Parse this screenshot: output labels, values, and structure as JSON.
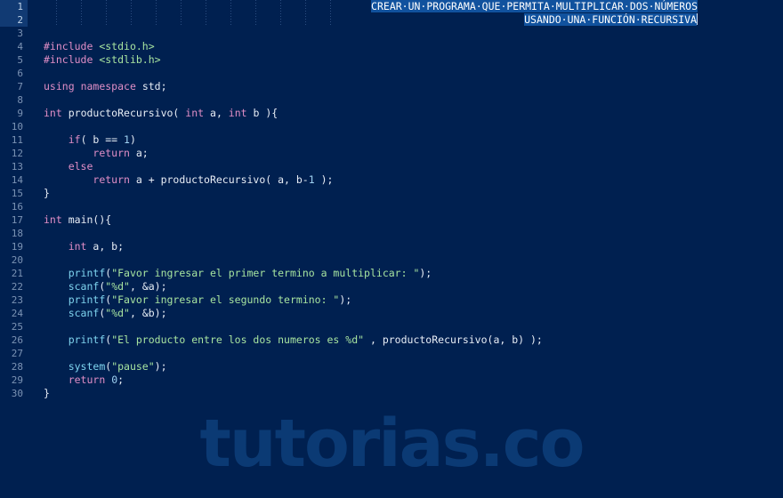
{
  "editor": {
    "watermark": "tutorias.co",
    "colors": {
      "background": "#002050",
      "gutter_text": "#7b93b4",
      "selection": "#11529e",
      "keyword": "#e08ec6",
      "string": "#a7e4a0",
      "function": "#7fd4ef",
      "number": "#9fd2f2",
      "identifier": "#e8eef6",
      "watermark": "#0b3a74"
    },
    "selected_text": "CREAR UN PROGRAMA QUE PERMITA MULTIPLICAR DOS NÚMEROS USANDO UNA FUNCIÓN RECURSIVA",
    "title_line_1": "CREAR·UN·PROGRAMA·QUE·PERMITA·MULTIPLICAR·DOS·NÚMEROS",
    "title_line_2": "USANDO·UNA·FUNCIÓN·RECURSIVA",
    "line_numbers": [
      1,
      2,
      3,
      4,
      5,
      6,
      7,
      8,
      9,
      10,
      11,
      12,
      13,
      14,
      15,
      16,
      17,
      18,
      19,
      20,
      21,
      22,
      23,
      24,
      25,
      26,
      27,
      28,
      29,
      30
    ],
    "code_lines": [
      {
        "n": 1,
        "text": ""
      },
      {
        "n": 2,
        "text": ""
      },
      {
        "n": 3,
        "text": ""
      },
      {
        "n": 4,
        "text": "#include <stdio.h>"
      },
      {
        "n": 5,
        "text": "#include <stdlib.h>"
      },
      {
        "n": 6,
        "text": ""
      },
      {
        "n": 7,
        "text": "using namespace std;"
      },
      {
        "n": 8,
        "text": ""
      },
      {
        "n": 9,
        "text": "int productoRecursivo( int a, int b ){"
      },
      {
        "n": 10,
        "text": ""
      },
      {
        "n": 11,
        "text": "    if( b == 1)"
      },
      {
        "n": 12,
        "text": "        return a;"
      },
      {
        "n": 13,
        "text": "    else"
      },
      {
        "n": 14,
        "text": "        return a + productoRecursivo( a, b-1 );"
      },
      {
        "n": 15,
        "text": "}"
      },
      {
        "n": 16,
        "text": ""
      },
      {
        "n": 17,
        "text": "int main(){"
      },
      {
        "n": 18,
        "text": ""
      },
      {
        "n": 19,
        "text": "    int a, b;"
      },
      {
        "n": 20,
        "text": ""
      },
      {
        "n": 21,
        "text": "    printf(\"Favor ingresar el primer termino a multiplicar: \");"
      },
      {
        "n": 22,
        "text": "    scanf(\"%d\", &a);"
      },
      {
        "n": 23,
        "text": "    printf(\"Favor ingresar el segundo termino: \");"
      },
      {
        "n": 24,
        "text": "    scanf(\"%d\", &b);"
      },
      {
        "n": 25,
        "text": ""
      },
      {
        "n": 26,
        "text": "    printf(\"El producto entre los dos numeros es %d\" , productoRecursivo(a, b) );"
      },
      {
        "n": 27,
        "text": ""
      },
      {
        "n": 28,
        "text": "    system(\"pause\");"
      },
      {
        "n": 29,
        "text": "    return 0;"
      },
      {
        "n": 30,
        "text": "}"
      }
    ],
    "tokens": {
      "include": "#include",
      "stdio": "<stdio.h>",
      "stdlib": "<stdlib.h>",
      "using": "using",
      "namespace": "namespace",
      "std": "std;",
      "int": "int",
      "productoRecursivo": "productoRecursivo",
      "sig_open": "( ",
      "a": "a",
      "comma_sp": ", ",
      "b": "b",
      "sig_close": " ){",
      "if": "if",
      "if_cond": "( b == ",
      "one": "1",
      "paren_close": ")",
      "return": "return",
      "ret_a": " a;",
      "else": "else",
      "ret_expr_pre": " a + ",
      "call_open": "( a, b-",
      "call_tail": " );",
      "brace_close": "}",
      "main": "main",
      "main_sig": "(){",
      "decl_ab": " a, b;",
      "printf": "printf",
      "scanf": "scanf",
      "system": "system",
      "str1": "\"Favor ingresar el primer termino a multiplicar: \"",
      "str2": "\"%d\"",
      "str3": "\"Favor ingresar el segundo termino: \"",
      "str4": "\"El producto entre los dos numeros es %d\"",
      "str5": "\"pause\"",
      "paren": "(",
      "tail_semicolon": ");",
      "amp_a": ", &a);",
      "amp_b": ", &b);",
      "p26_tail": " , productoRecursivo(a, b) );",
      "zero": "0",
      "zero_semi": ";"
    }
  }
}
